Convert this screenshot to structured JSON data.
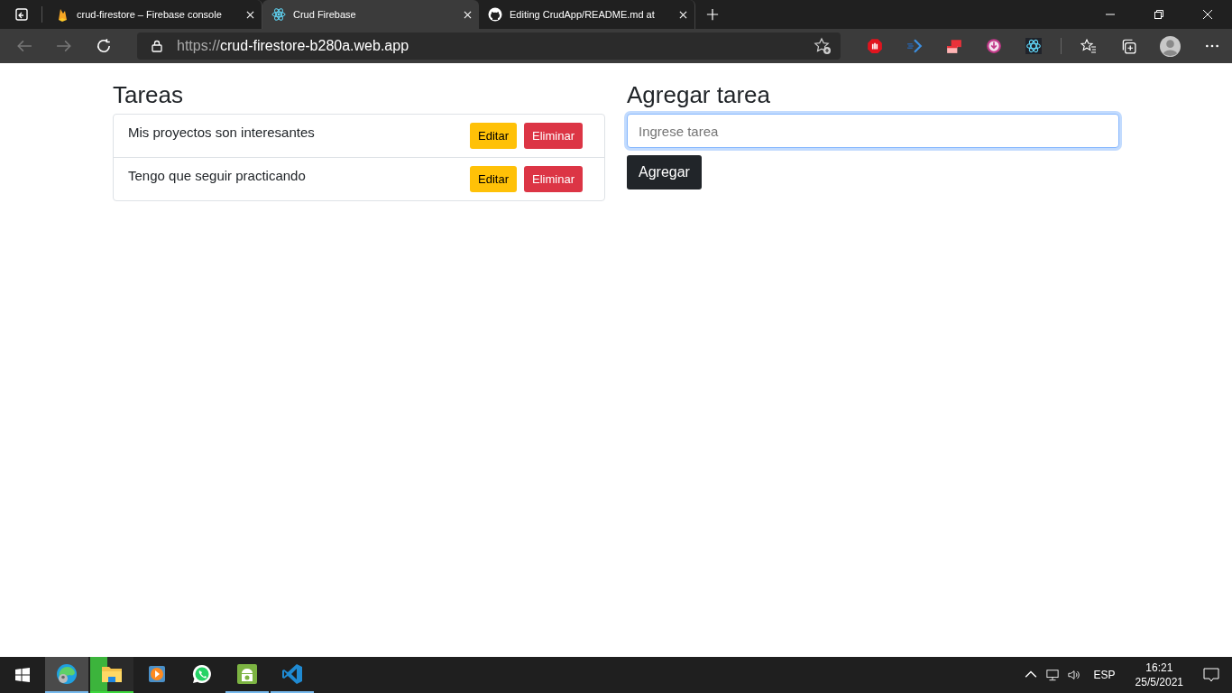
{
  "browser": {
    "tabs": [
      {
        "title": "crud-firestore – Firebase console",
        "selected": false
      },
      {
        "title": "Crud Firebase",
        "selected": true
      },
      {
        "title": "Editing CrudApp/README.md at",
        "selected": false
      }
    ],
    "address": {
      "scheme": "https://",
      "host": "crud-firestore-b280a.web.app"
    }
  },
  "tasks": {
    "title": "Tareas",
    "items": [
      {
        "text": "Mis proyectos son interesantes",
        "edit": "Editar",
        "delete": "Eliminar"
      },
      {
        "text": "Tengo que seguir practicando",
        "edit": "Editar",
        "delete": "Eliminar"
      }
    ]
  },
  "form": {
    "title": "Agregar tarea",
    "input": {
      "placeholder": "Ingrese tarea",
      "focused": true
    },
    "button": "Agregar"
  },
  "taskbar": {
    "apps": [
      {
        "selected": true,
        "running": true,
        "attention": false
      },
      {
        "selected": false,
        "running": true,
        "attention": true
      },
      {
        "selected": false,
        "running": false,
        "attention": false
      },
      {
        "selected": false,
        "running": false,
        "attention": false
      },
      {
        "selected": false,
        "running": true,
        "attention": false
      },
      {
        "selected": false,
        "running": true,
        "attention": false
      }
    ],
    "language": "ESP",
    "time": "16:21",
    "date": "25/5/2021"
  }
}
